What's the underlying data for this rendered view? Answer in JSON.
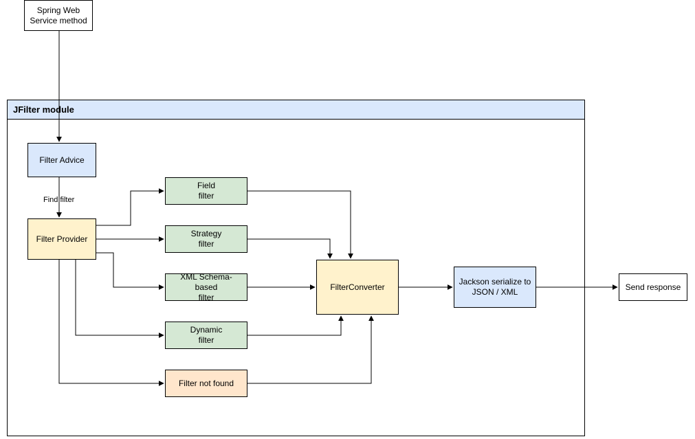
{
  "module_title": "JFilter module",
  "spring_box": "Spring Web Service method",
  "filter_advice": "Filter Advice",
  "find_filter_label": "Find filter",
  "filter_provider": "Filter Provider",
  "field_filter_l1": "Field",
  "field_filter_l2": "filter",
  "strategy_filter_l1": "Strategy",
  "strategy_filter_l2": "filter",
  "xml_filter_l1": "XML Schema-based",
  "xml_filter_l2": "filter",
  "dynamic_filter_l1": "Dynamic",
  "dynamic_filter_l2": "filter",
  "filter_not_found": "Filter not found",
  "filter_converter": "FilterConverter",
  "jackson_l1": "Jackson serialize to",
  "jackson_l2": "JSON / XML",
  "send_response": "Send response"
}
